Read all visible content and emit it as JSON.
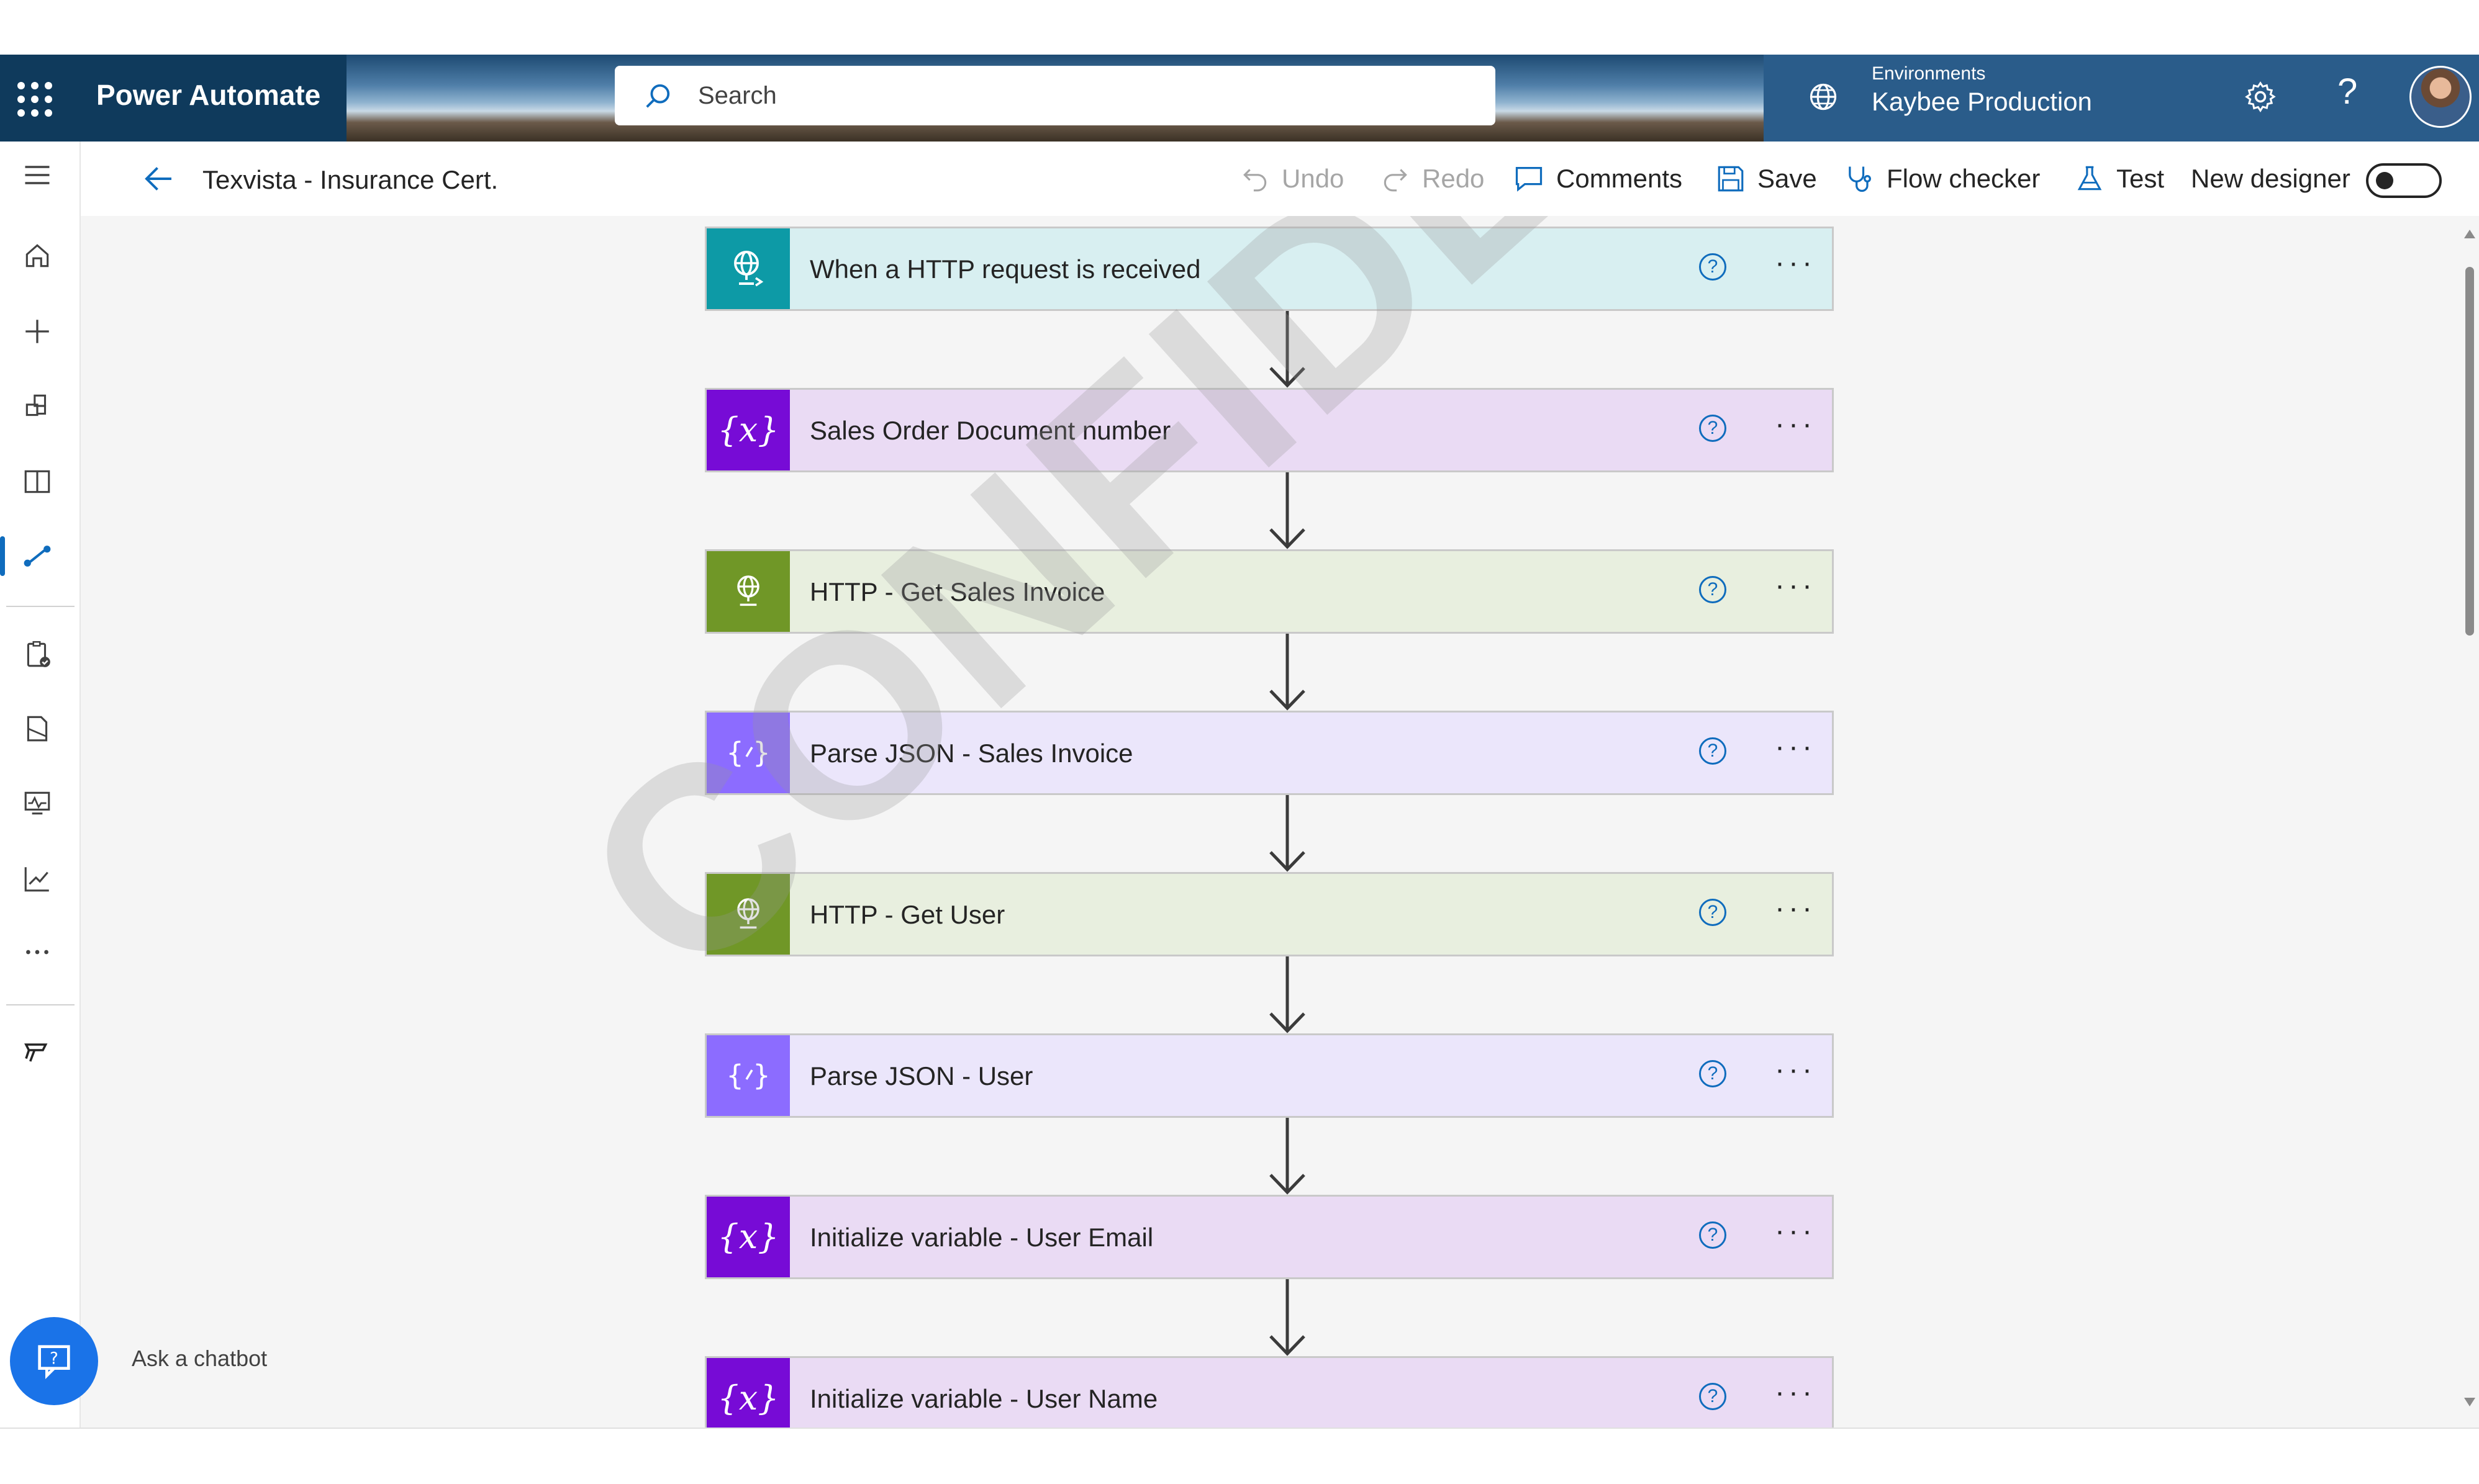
{
  "app": {
    "name": "Power Automate"
  },
  "search": {
    "placeholder": "Search"
  },
  "environment": {
    "label": "Environments",
    "name": "Kaybee Production"
  },
  "header": {
    "help": "?"
  },
  "flow": {
    "name": "Texvista - Insurance Cert."
  },
  "toolbar": {
    "undo": "Undo",
    "redo": "Redo",
    "comments": "Comments",
    "save": "Save",
    "flow_checker": "Flow checker",
    "test": "Test",
    "new_designer": "New designer",
    "new_designer_enabled": false
  },
  "left_nav": [
    {
      "name": "home",
      "icon": "home-icon"
    },
    {
      "name": "create",
      "icon": "plus-icon"
    },
    {
      "name": "templates",
      "icon": "templates-icon"
    },
    {
      "name": "learn",
      "icon": "book-icon"
    },
    {
      "name": "my-flows",
      "icon": "flow-icon",
      "selected": true
    },
    {
      "name": "approvals",
      "icon": "clipboard-check-icon"
    },
    {
      "name": "solutions",
      "icon": "solutions-icon"
    },
    {
      "name": "process-mining",
      "icon": "monitor-icon"
    },
    {
      "name": "analytics",
      "icon": "chart-icon"
    },
    {
      "name": "more",
      "icon": "more-icon"
    },
    {
      "name": "power-platform",
      "icon": "power-platform-icon"
    }
  ],
  "steps": [
    {
      "title": "When a HTTP request is received",
      "kind": "http-request",
      "icon_bg": "#0d9aa6",
      "card_bg": "#d8eff1"
    },
    {
      "title": "Sales Order Document number",
      "kind": "variable",
      "icon_bg": "#770bd6",
      "card_bg": "#eadbf4"
    },
    {
      "title": "HTTP - Get Sales Invoice",
      "kind": "http",
      "icon_bg": "#709727",
      "card_bg": "#e8efdf"
    },
    {
      "title": "Parse JSON - Sales Invoice",
      "kind": "parse-json",
      "icon_bg": "#8c6cff",
      "card_bg": "#ebe6fb"
    },
    {
      "title": "HTTP - Get User",
      "kind": "http",
      "icon_bg": "#709727",
      "card_bg": "#e8efdf"
    },
    {
      "title": "Parse JSON - User",
      "kind": "parse-json",
      "icon_bg": "#8c6cff",
      "card_bg": "#ebe6fb"
    },
    {
      "title": "Initialize variable - User Email",
      "kind": "variable",
      "icon_bg": "#770bd6",
      "card_bg": "#eadbf4"
    },
    {
      "title": "Initialize variable - User Name",
      "kind": "variable",
      "icon_bg": "#770bd6",
      "card_bg": "#eadbf4"
    }
  ],
  "step_help": "?",
  "step_more": "···",
  "watermark": "CONFIDENTIAL",
  "chatbot": {
    "label": "Ask a chatbot"
  }
}
